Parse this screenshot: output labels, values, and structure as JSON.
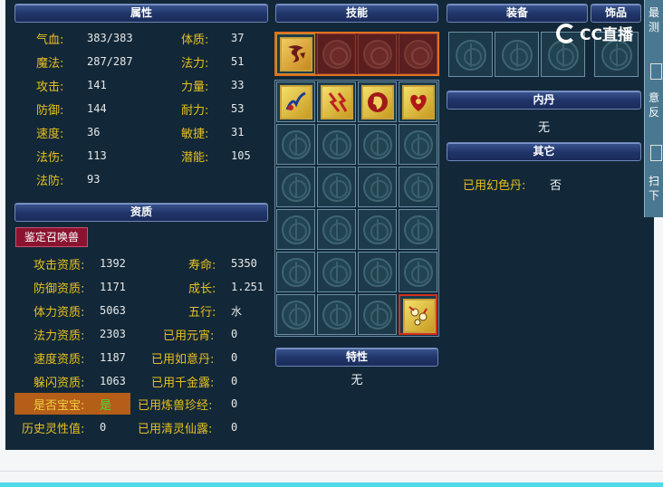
{
  "headers": {
    "attributes": "属性",
    "skills": "技能",
    "equipment": "装备",
    "ornament": "饰品",
    "qualification": "资质",
    "inner_pill": "内丹",
    "other": "其它",
    "traits": "特性"
  },
  "attributes": {
    "hp": {
      "label": "气血:",
      "value": "383/383"
    },
    "mp": {
      "label": "魔法:",
      "value": "287/287"
    },
    "atk": {
      "label": "攻击:",
      "value": "141"
    },
    "def": {
      "label": "防御:",
      "value": "144"
    },
    "spd": {
      "label": "速度:",
      "value": "36"
    },
    "mdmg": {
      "label": "法伤:",
      "value": "113"
    },
    "mdef": {
      "label": "法防:",
      "value": "93"
    },
    "con": {
      "label": "体质:",
      "value": "37"
    },
    "mag": {
      "label": "法力:",
      "value": "51"
    },
    "str": {
      "label": "力量:",
      "value": "33"
    },
    "end": {
      "label": "耐力:",
      "value": "53"
    },
    "agi": {
      "label": "敏捷:",
      "value": "31"
    },
    "pot": {
      "label": "潜能:",
      "value": "105"
    }
  },
  "identify_button": "鉴定召唤兽",
  "qualification": {
    "atk_q": {
      "label": "攻击资质:",
      "value": "1392"
    },
    "def_q": {
      "label": "防御资质:",
      "value": "1171"
    },
    "hp_q": {
      "label": "体力资质:",
      "value": "5063"
    },
    "mag_q": {
      "label": "法力资质:",
      "value": "2303"
    },
    "spd_q": {
      "label": "速度资质:",
      "value": "1187"
    },
    "dodge_q": {
      "label": "躲闪资质:",
      "value": "1063"
    },
    "is_baby": {
      "label": "是否宝宝:",
      "value": "是"
    },
    "history": {
      "label": "历史灵性值:",
      "value": "0"
    },
    "life": {
      "label": "寿命:",
      "value": "5350"
    },
    "growth": {
      "label": "成长:",
      "value": "1.251"
    },
    "element": {
      "label": "五行:",
      "value": "水"
    },
    "yuanxiao": {
      "label": "已用元宵:",
      "value": "0"
    },
    "ruyi": {
      "label": "已用如意丹:",
      "value": "0"
    },
    "qianjin": {
      "label": "已用千金露:",
      "value": "0"
    },
    "lianshou": {
      "label": "已用炼兽珍经:",
      "value": "0"
    },
    "qingling": {
      "label": "已用清灵仙露:",
      "value": "0"
    }
  },
  "inner_pill_value": "无",
  "other_items": {
    "label": "已用幻色丹:",
    "value": "否"
  },
  "traits_value": "无",
  "watermark": "CC直播",
  "side_tab": {
    "top_chars": "最\n测",
    "mid_chars": "意\n反",
    "bot_chars": "扫\n下"
  },
  "skills": [
    "special-rune-icon",
    "lightning-icon",
    "thunder-icon",
    "mind-icon",
    "heart-icon",
    "stones-icon"
  ]
}
